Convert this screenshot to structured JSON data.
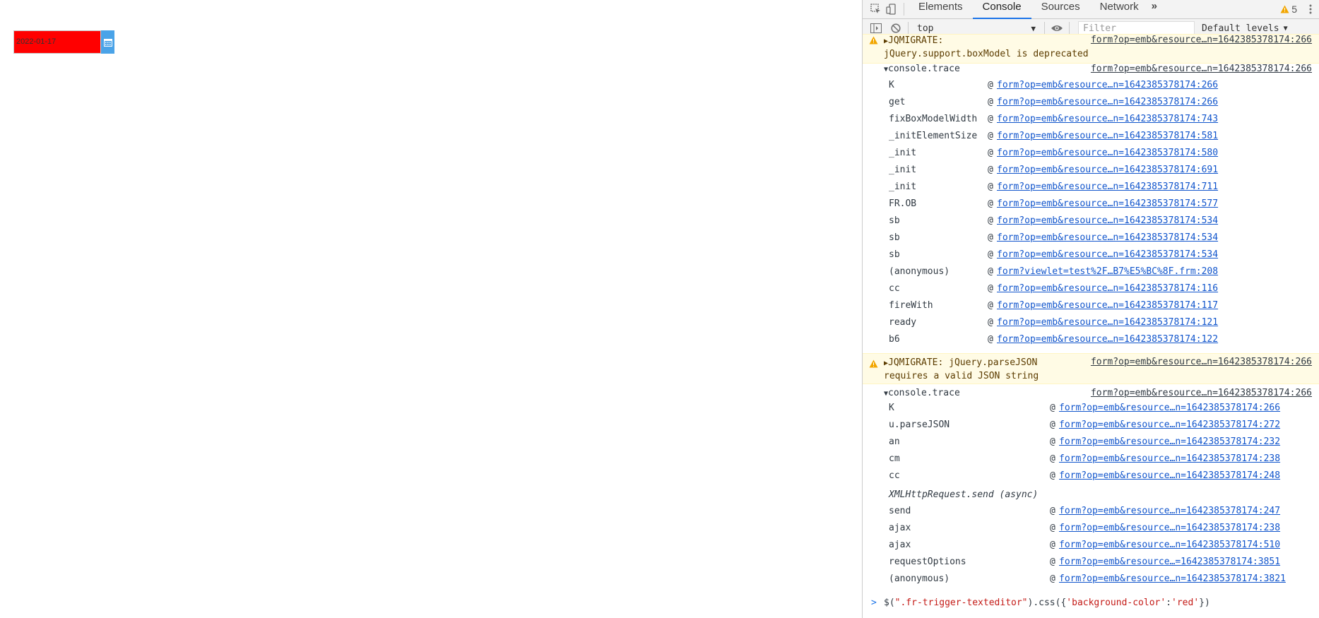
{
  "page": {
    "date_value": "2022-01-17"
  },
  "devtools": {
    "tabs": [
      "Elements",
      "Console",
      "Sources",
      "Network"
    ],
    "active_tab": "Console",
    "more_tabs": "»",
    "warning_count": "5",
    "toolbar": {
      "context": "top",
      "filter_placeholder": "Filter",
      "levels": "Default levels"
    },
    "messages": {
      "top_warning_line1": "JQMIGRATE:",
      "top_warning_line2": "jQuery.support.boxModel is deprecated",
      "top_warning_src": "form?op=emb&resource…n=1642385378174:266",
      "trace1": {
        "label": "console.trace",
        "src": "form?op=emb&resource…n=1642385378174:266",
        "frames": [
          {
            "fn": "K",
            "link": "form?op=emb&resource…n=1642385378174:266"
          },
          {
            "fn": "get",
            "link": "form?op=emb&resource…n=1642385378174:266"
          },
          {
            "fn": "fixBoxModelWidth",
            "link": "form?op=emb&resource…n=1642385378174:743"
          },
          {
            "fn": "_initElementSize",
            "link": "form?op=emb&resource…n=1642385378174:581"
          },
          {
            "fn": "_init",
            "link": "form?op=emb&resource…n=1642385378174:580"
          },
          {
            "fn": "_init",
            "link": "form?op=emb&resource…n=1642385378174:691"
          },
          {
            "fn": "_init",
            "link": "form?op=emb&resource…n=1642385378174:711"
          },
          {
            "fn": "FR.OB",
            "link": "form?op=emb&resource…n=1642385378174:577"
          },
          {
            "fn": "sb",
            "link": "form?op=emb&resource…n=1642385378174:534"
          },
          {
            "fn": "sb",
            "link": "form?op=emb&resource…n=1642385378174:534"
          },
          {
            "fn": "sb",
            "link": "form?op=emb&resource…n=1642385378174:534"
          },
          {
            "fn": "(anonymous)",
            "link": "form?viewlet=test%2F…B7%E5%BC%8F.frm:208"
          },
          {
            "fn": "cc",
            "link": "form?op=emb&resource…n=1642385378174:116"
          },
          {
            "fn": "fireWith",
            "link": "form?op=emb&resource…n=1642385378174:117"
          },
          {
            "fn": "ready",
            "link": "form?op=emb&resource…n=1642385378174:121"
          },
          {
            "fn": "b6",
            "link": "form?op=emb&resource…n=1642385378174:122"
          }
        ]
      },
      "warning2_line1": "JQMIGRATE: jQuery.parseJSON",
      "warning2_line2": "requires a valid JSON string",
      "warning2_src": "form?op=emb&resource…n=1642385378174:266",
      "trace2": {
        "label": "console.trace",
        "src": "form?op=emb&resource…n=1642385378174:266",
        "frames": [
          {
            "fn": "K",
            "link": "form?op=emb&resource…n=1642385378174:266"
          },
          {
            "fn": "u.parseJSON",
            "link": "form?op=emb&resource…n=1642385378174:272"
          },
          {
            "fn": "an",
            "link": "form?op=emb&resource…n=1642385378174:232"
          },
          {
            "fn": "cm",
            "link": "form?op=emb&resource…n=1642385378174:238"
          },
          {
            "fn": "cc",
            "link": "form?op=emb&resource…n=1642385378174:248"
          }
        ],
        "async_label": "XMLHttpRequest.send (async)",
        "frames_after": [
          {
            "fn": "send",
            "link": "form?op=emb&resource…n=1642385378174:247"
          },
          {
            "fn": "ajax",
            "link": "form?op=emb&resource…n=1642385378174:238"
          },
          {
            "fn": "ajax",
            "link": "form?op=emb&resource…n=1642385378174:510"
          },
          {
            "fn": "requestOptions",
            "link": "form?op=emb&resource…=1642385378174:3851"
          },
          {
            "fn": "(anonymous)",
            "link": "form?op=emb&resource…n=1642385378174:3821"
          }
        ]
      }
    },
    "prompt": {
      "caret": ">",
      "part1": "$(",
      "part2": "\".fr-trigger-texteditor\"",
      "part3": ").css({",
      "part4": "'background-color'",
      "part5": ":",
      "part6": "'red'",
      "part7": "})"
    },
    "colors": {
      "warning_bg": "#fffbe5",
      "link": "#1155cc",
      "string": "#c41a16",
      "date_bg": "#ff0000",
      "trigger_bg": "#4aa3e8"
    }
  }
}
